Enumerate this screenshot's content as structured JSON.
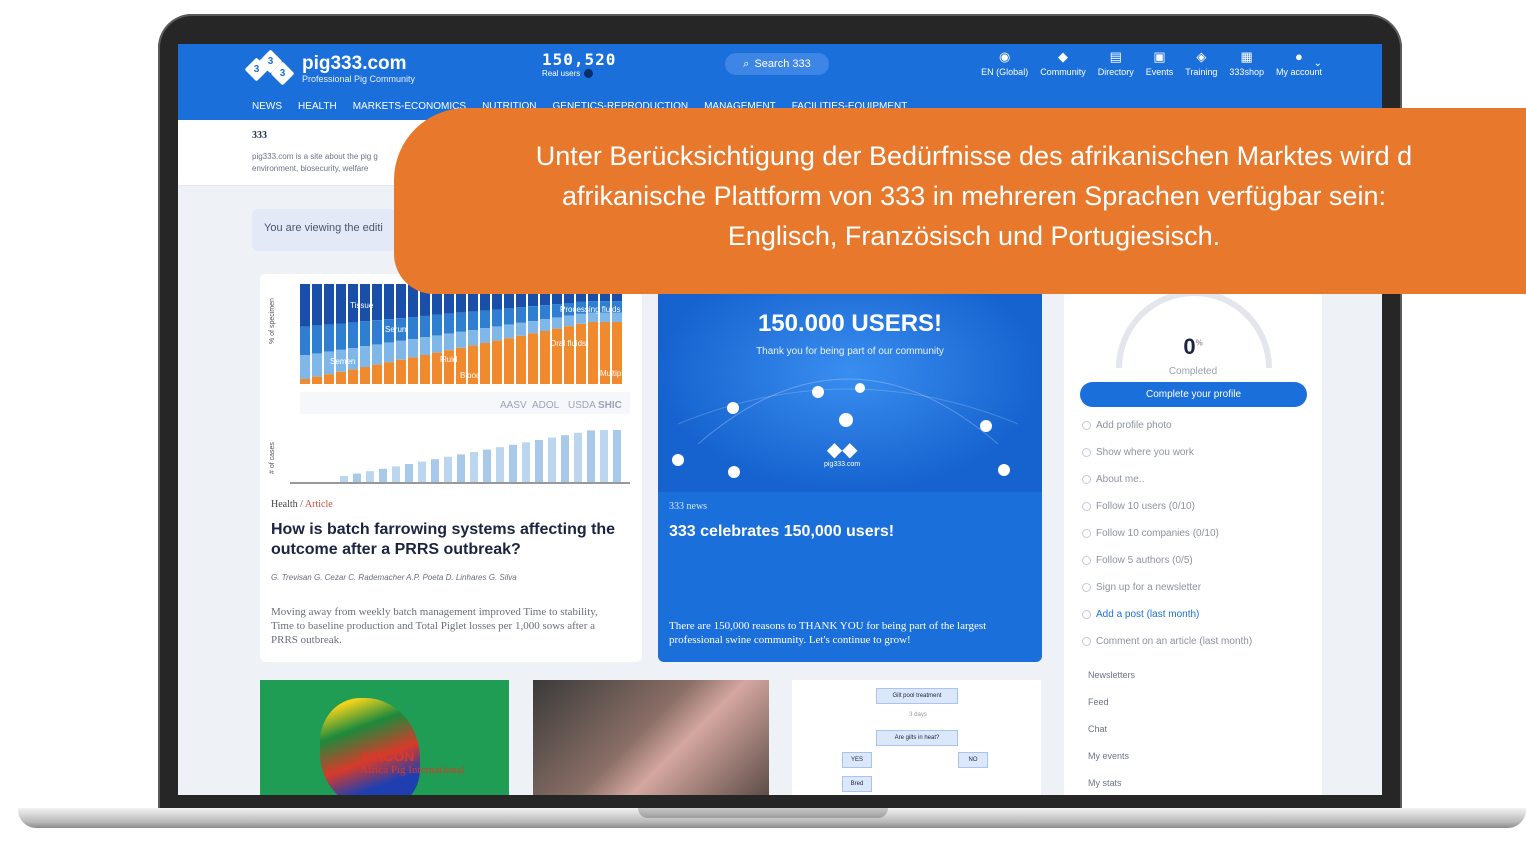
{
  "site": {
    "name": "pig333.com",
    "tagline": "Professional Pig Community",
    "logo_digits": [
      "3",
      "3",
      "3"
    ],
    "users_count": "150,520",
    "users_label": "Real users",
    "search_placeholder": "Search 333",
    "accent_color": "#1a6fdb"
  },
  "nav": [
    {
      "icon": "globe-icon",
      "glyph": "◉",
      "label": "EN (Global)"
    },
    {
      "icon": "community-icon",
      "glyph": "◆",
      "label": "Community"
    },
    {
      "icon": "directory-icon",
      "glyph": "▤",
      "label": "Directory"
    },
    {
      "icon": "events-icon",
      "glyph": "▣",
      "label": "Events"
    },
    {
      "icon": "training-icon",
      "glyph": "◈",
      "label": "Training"
    },
    {
      "icon": "shop-icon",
      "glyph": "▦",
      "label": "333shop"
    },
    {
      "icon": "account-icon",
      "glyph": "●",
      "label": "My account"
    }
  ],
  "categories": [
    "NEWS",
    "HEALTH",
    "MARKETS-ECONOMICS",
    "NUTRITION",
    "GENETICS-REPRODUCTION",
    "MANAGEMENT",
    "FACILITIES-EQUIPMENT"
  ],
  "intro": {
    "title": "333",
    "text": "pig333.com is a site about the pig g environment, biosecurity, welfare"
  },
  "viewing_notice": "You are viewing the editi",
  "cards": [
    {
      "section": "Health",
      "type": "Article",
      "title": "How is batch farrowing systems affecting the outcome after a PRRS outbreak?",
      "authors": "G. Trevisan   G. Cezar   C. Rademacher   A.P. Poeta   D. Linhares   G. Silva",
      "description": "Moving away from weekly batch management improved Time to stability, Time to baseline production and Total Piglet losses per 1,000 sows after a PRRS outbreak.",
      "image": {
        "y_label_top": "% of specimen",
        "y_label_bottom": "# of cases",
        "area_labels": [
          "Tissue",
          "Serum",
          "Semen",
          "Fluid",
          "Oral fluids",
          "Processing fluids",
          "Blood",
          "Multiple"
        ],
        "logos": [
          "AASV",
          "ADOL",
          "USDA",
          "SHIC"
        ]
      }
    },
    {
      "section": "333 news",
      "title": "333 celebrates 150,000 users!",
      "banner_title": "150.000 USERS!",
      "banner_sub": "Thank you for being part of our community",
      "banner_site": "pig333.com",
      "description": "There are 150,000 reasons to THANK YOU for being part of the largest professional swine community. Let's continue to grow!"
    }
  ],
  "profile": {
    "completion_percent": 0,
    "completion_value": "0",
    "completion_unit": "%",
    "completion_label": "Completed",
    "button": "Complete your profile",
    "tasks": [
      {
        "label": "Add profile photo",
        "highlight": false
      },
      {
        "label": "Show where you work",
        "highlight": false
      },
      {
        "label": "About me..",
        "highlight": false
      },
      {
        "label": "Follow 10 users (0/10)",
        "highlight": false
      },
      {
        "label": "Follow 10 companies (0/10)",
        "highlight": false
      },
      {
        "label": "Follow 5 authors (0/5)",
        "highlight": false
      },
      {
        "label": "Sign up for a newsletter",
        "highlight": false
      },
      {
        "label": "Add a post (last month)",
        "highlight": true
      },
      {
        "label": "Comment on an article (last month)",
        "highlight": false
      }
    ],
    "links": [
      "Newsletters",
      "Feed",
      "Chat",
      "My events",
      "My stats"
    ]
  },
  "bottom_cards": {
    "apicon_title": "APICON",
    "apicon_sub": "Africa Pig International",
    "flow_labels": [
      "Gilt pool treatment",
      "3 days",
      "Are gilts in heat?",
      "YES",
      "NO",
      "Bred"
    ]
  },
  "callout": {
    "text": "Unter Berücksichtigung der Bedürfnisse des afrikanischen Marktes wird d\nafrikanische Plattform von 333 in mehreren Sprachen verfügbar sein:\nEnglisch, Französisch und Portugiesisch.",
    "color": "#e8782c"
  }
}
